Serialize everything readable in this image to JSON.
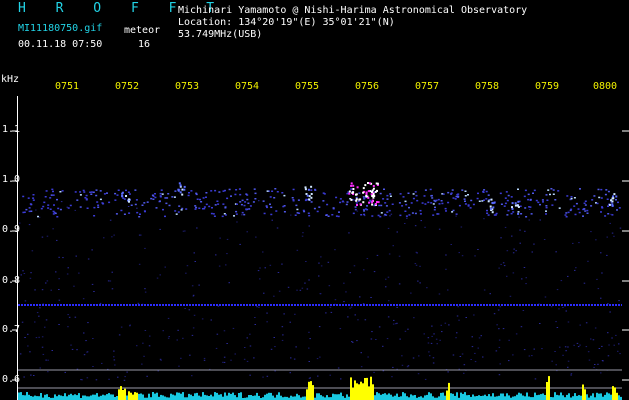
{
  "header": {
    "program": "H R O F F T",
    "filename": "MI11180750.gif",
    "datetime": "00.11.18 07:50",
    "meteor_label": "meteor",
    "meteor_count": "16",
    "observer": "Michinari Yamamoto @ Nishi-Harima Astronomical Observatory",
    "location": "Location: 134°20'19\"(E) 35°01'21\"(N)",
    "frequency": "53.749MHz(USB)"
  },
  "axes": {
    "y_unit": "kHz",
    "y_ticks": [
      "1.1",
      "1.0",
      "0.9",
      "0.8",
      "0.7",
      "0.6"
    ],
    "x_ticks": [
      "0751",
      "0752",
      "0753",
      "0754",
      "0755",
      "0756",
      "0757",
      "0758",
      "0759",
      "0800"
    ]
  },
  "colors": {
    "background": "#000000",
    "header_cyan": "#22d3e6",
    "header_white": "#ffffff",
    "time_yellow": "#f2f200",
    "signal_blue": "#3b3bd6",
    "baseline_blue": "#2c2cff",
    "meteor_magenta": "#ff2cff",
    "amplitude_cyan": "#19c8e0",
    "amplitude_yellow": "#ffff00"
  }
}
